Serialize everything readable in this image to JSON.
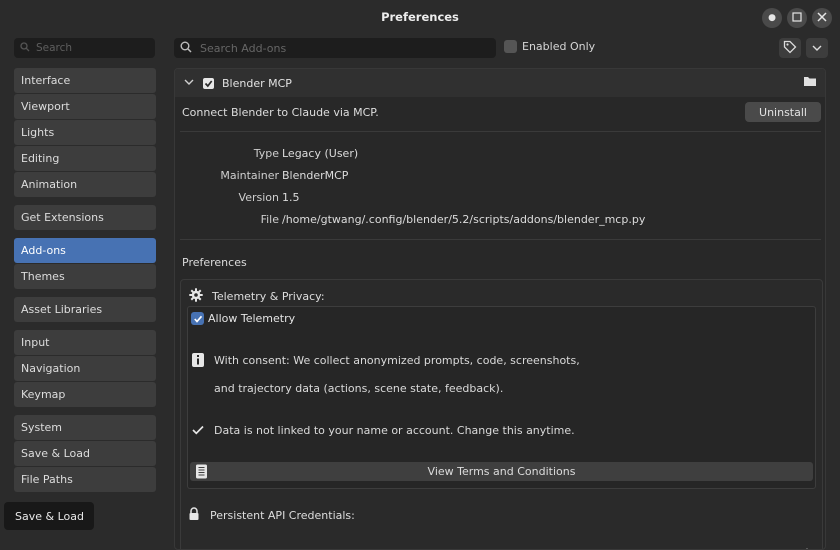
{
  "window": {
    "title": "Preferences",
    "controls": [
      "dot-icon",
      "maximize-icon",
      "close-icon"
    ]
  },
  "sidebar": {
    "search_placeholder": "Search",
    "groups": [
      [
        {
          "label": "Interface"
        },
        {
          "label": "Viewport"
        },
        {
          "label": "Lights"
        },
        {
          "label": "Editing"
        },
        {
          "label": "Animation"
        }
      ],
      [
        {
          "label": "Get Extensions"
        }
      ],
      [
        {
          "label": "Add-ons",
          "active": true
        },
        {
          "label": "Themes"
        }
      ],
      [
        {
          "label": "Asset Libraries"
        }
      ],
      [
        {
          "label": "Input"
        },
        {
          "label": "Navigation"
        },
        {
          "label": "Keymap"
        }
      ],
      [
        {
          "label": "System"
        },
        {
          "label": "Save & Load"
        },
        {
          "label": "File Paths"
        }
      ]
    ],
    "tooltip": "Save & Load"
  },
  "toolbar": {
    "search_placeholder": "Search Add-ons",
    "enabled_only_label": "Enabled Only",
    "enabled_only_checked": false
  },
  "addon": {
    "name": "Blender MCP",
    "enabled": true,
    "description": "Connect Blender to Claude via MCP.",
    "uninstall_label": "Uninstall",
    "info": [
      {
        "key": "Type",
        "value": "Legacy (User)"
      },
      {
        "key": "Maintainer",
        "value": "BlenderMCP"
      },
      {
        "key": "Version",
        "value": "1.5"
      },
      {
        "key": "File",
        "value": "/home/gtwang/.config/blender/5.2/scripts/addons/blender_mcp.py"
      }
    ],
    "preferences_label": "Preferences",
    "telemetry": {
      "title": "Telemetry & Privacy:",
      "allow_label": "Allow Telemetry",
      "allow_checked": true,
      "consent_line1": "With consent: We collect anonymized prompts, code, screenshots,",
      "consent_line2": "and trajectory data (actions, scene state, feedback).",
      "not_linked": "Data is not linked to your name or account. Change this anytime.",
      "terms_button": "View Terms and Conditions"
    },
    "credentials_title": "Persistent API Credentials:"
  },
  "colors": {
    "accent": "#4772b3",
    "panel_bg": "#2b2b2b",
    "field_bg": "#1d1d1d"
  }
}
